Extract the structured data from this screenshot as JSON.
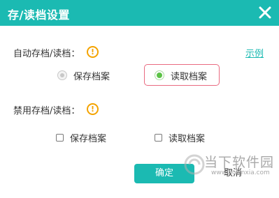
{
  "dialog": {
    "title": "存/读档设置",
    "close_icon": "close-x",
    "accent_color": "#1bbab2"
  },
  "auto_section": {
    "label": "自动存档/读档：",
    "warn_icon": "warning-icon",
    "warn_glyph": "!",
    "example_link": "示例",
    "options": [
      {
        "label": "保存档案",
        "selected": false
      },
      {
        "label": "读取档案",
        "selected": true
      }
    ]
  },
  "disable_section": {
    "label": "禁用存档/读档：",
    "warn_glyph": "!",
    "options": [
      {
        "label": "保存档案",
        "checked": false
      },
      {
        "label": "读取档案",
        "checked": false
      }
    ]
  },
  "buttons": {
    "ok_label": "确定",
    "cancel_label": "取消"
  },
  "watermark": {
    "text": "当下软件园",
    "url": "www.downxia.com"
  }
}
